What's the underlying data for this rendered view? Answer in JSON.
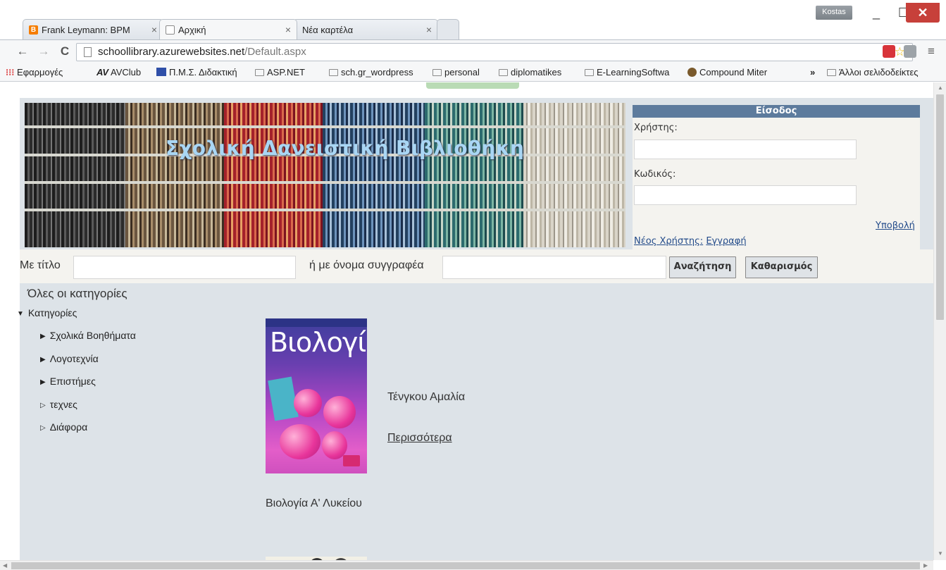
{
  "browser": {
    "user_badge": "Kostas",
    "tabs": [
      {
        "title": "Frank Leymann: BPM",
        "close": "×"
      },
      {
        "title": "Αρχική",
        "close": "×"
      },
      {
        "title": "Νέα καρτέλα",
        "close": "×"
      }
    ],
    "window_buttons": {
      "minimize": "_",
      "maximize": "☐",
      "close": "✕"
    },
    "url": {
      "host": "schoollibrary.azurewebsites.net",
      "path": "/Default.aspx"
    },
    "nav": {
      "back": "←",
      "forward": "→",
      "reload": "C"
    },
    "star": "☆",
    "menu": "≡",
    "bookmarks": {
      "apps": "Εφαρμογές",
      "items": [
        "AVClub",
        "Π.Μ.Σ. Διδακτική",
        "ASP.NET",
        "sch.gr_wordpress",
        "personal",
        "diplomatikes",
        "E-LearningSoftwa",
        "Compound Miter"
      ],
      "more": "»",
      "other": "Άλλοι σελιδοδείκτες"
    }
  },
  "page": {
    "banner_title": "Σχολική Δανειστική Βιβλιοθήκη",
    "login": {
      "header": "Είσοδος",
      "user_label": "Χρήστης:",
      "user_value": "",
      "password_label": "Κωδικός:",
      "password_value": "",
      "submit": "Υποβολή",
      "register_prefix": "Νέος Χρήστης:",
      "register_link": "Εγγραφή"
    },
    "search": {
      "title_label": "Με τίτλο",
      "title_value": "",
      "author_label": "ή με όνομα συγγραφέα",
      "author_value": "",
      "search_button": "Αναζήτηση",
      "clear_button": "Καθαρισμός"
    },
    "categories": {
      "all": "Όλες οι κατηγορίες",
      "root": "Κατηγορίες",
      "items": [
        "Σχολικά Βοηθήματα",
        "Λογοτεχνία",
        "Επιστήμες",
        "τεχνες",
        "Διάφορα"
      ]
    },
    "book": {
      "cover_title": "Βιολογία",
      "title": "Βιολογία Α' Λυκείου",
      "author": "Τένγκου Αμαλία",
      "more_link": "Περισσότερα"
    }
  },
  "colors": {
    "page_bg": "#dde3e8",
    "panel_bg": "#f4f3ef",
    "login_header": "#5d7b9d",
    "link": "#234b8a",
    "banner_title": "#a9d6f4"
  }
}
